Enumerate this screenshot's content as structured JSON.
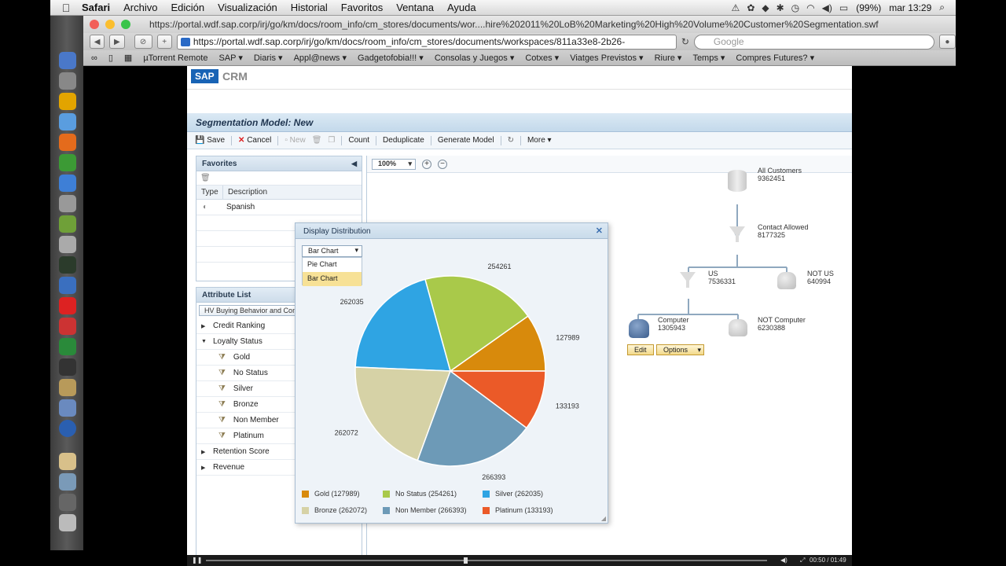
{
  "menubar": {
    "app": "Safari",
    "items": [
      "Archivo",
      "Edición",
      "Visualización",
      "Historial",
      "Favoritos",
      "Ventana",
      "Ayuda"
    ],
    "battery": "(99%)",
    "clock": "mar 13:29"
  },
  "browser": {
    "title": "https://portal.wdf.sap.corp/irj/go/km/docs/room_info/cm_stores/documents/wor....hire%202011%20LoB%20Marketing%20High%20Volume%20Customer%20Segmentation.swf",
    "url": "https://portal.wdf.sap.corp/irj/go/km/docs/room_info/cm_stores/documents/workspaces/811a33e8-2b26-",
    "search_placeholder": "Google",
    "bookmarks": [
      "µTorrent Remote",
      "SAP ▾",
      "Diaris ▾",
      "Appl@news ▾",
      "Gadgetofobia!!! ▾",
      "Consolas y Juegos ▾",
      "Cotxes ▾",
      "Viatges Previstos ▾",
      "Riure ▾",
      "Temps ▾",
      "Compres Futures? ▾"
    ]
  },
  "sap": {
    "logo": "SAP",
    "product": "CRM",
    "model_title": "Segmentation Model: New",
    "actions": {
      "save": "Save",
      "cancel": "Cancel",
      "new": "New",
      "count": "Count",
      "deduplicate": "Deduplicate",
      "generate": "Generate Model",
      "more": "More ▾"
    },
    "favorites": {
      "title": "Favorites",
      "col_type": "Type",
      "col_desc": "Description",
      "rows": [
        "Spanish"
      ]
    },
    "attributes": {
      "title": "Attribute List",
      "selector": "HV Buying Behavior and Con",
      "items": [
        {
          "label": "Credit Ranking",
          "kind": "collapsed"
        },
        {
          "label": "Loyalty Status",
          "kind": "expanded"
        },
        {
          "label": "Gold",
          "kind": "child"
        },
        {
          "label": "No Status",
          "kind": "child"
        },
        {
          "label": "Silver",
          "kind": "child"
        },
        {
          "label": "Bronze",
          "kind": "child"
        },
        {
          "label": "Non Member",
          "kind": "child"
        },
        {
          "label": "Platinum",
          "kind": "child"
        },
        {
          "label": "Retention Score",
          "kind": "collapsed"
        },
        {
          "label": "Revenue",
          "kind": "collapsed"
        }
      ]
    },
    "canvas": {
      "zoom": "100%",
      "nodes": {
        "all": {
          "label": "All Customers",
          "count": "9362451"
        },
        "contact": {
          "label": "Contact Allowed",
          "count": "8177325"
        },
        "us": {
          "label": "US",
          "count": "7536331"
        },
        "notus": {
          "label": "NOT US",
          "count": "640994"
        },
        "computer": {
          "label": "Computer",
          "count": "1305943"
        },
        "notcomputer": {
          "label": "NOT Computer",
          "count": "6230388"
        }
      },
      "edit": "Edit",
      "options": "Options"
    },
    "dialog": {
      "title": "Display Distribution",
      "chart_type_selected": "Bar Chart",
      "chart_type_options": [
        "Pie Chart",
        "Bar Chart"
      ]
    }
  },
  "chart_data": {
    "type": "pie",
    "categories": [
      "Gold",
      "No Status",
      "Silver",
      "Bronze",
      "Non Member",
      "Platinum"
    ],
    "values": [
      127989,
      254261,
      262035,
      262072,
      266393,
      133193
    ],
    "legend": [
      "Gold (127989)",
      "No Status (254261)",
      "Silver (262035)",
      "Bronze (262072)",
      "Non Member (266393)",
      "Platinum (133193)"
    ],
    "data_labels": [
      "127989",
      "254261",
      "262035",
      "262072",
      "266393",
      "133193"
    ],
    "colors": [
      "#d88a0c",
      "#a9c94a",
      "#2fa4e3",
      "#d6d2a6",
      "#6d9ab7",
      "#eb5a28"
    ],
    "legend_position": "bottom"
  },
  "video": {
    "time": "00:50 / 01:49",
    "progress": 0.46
  }
}
